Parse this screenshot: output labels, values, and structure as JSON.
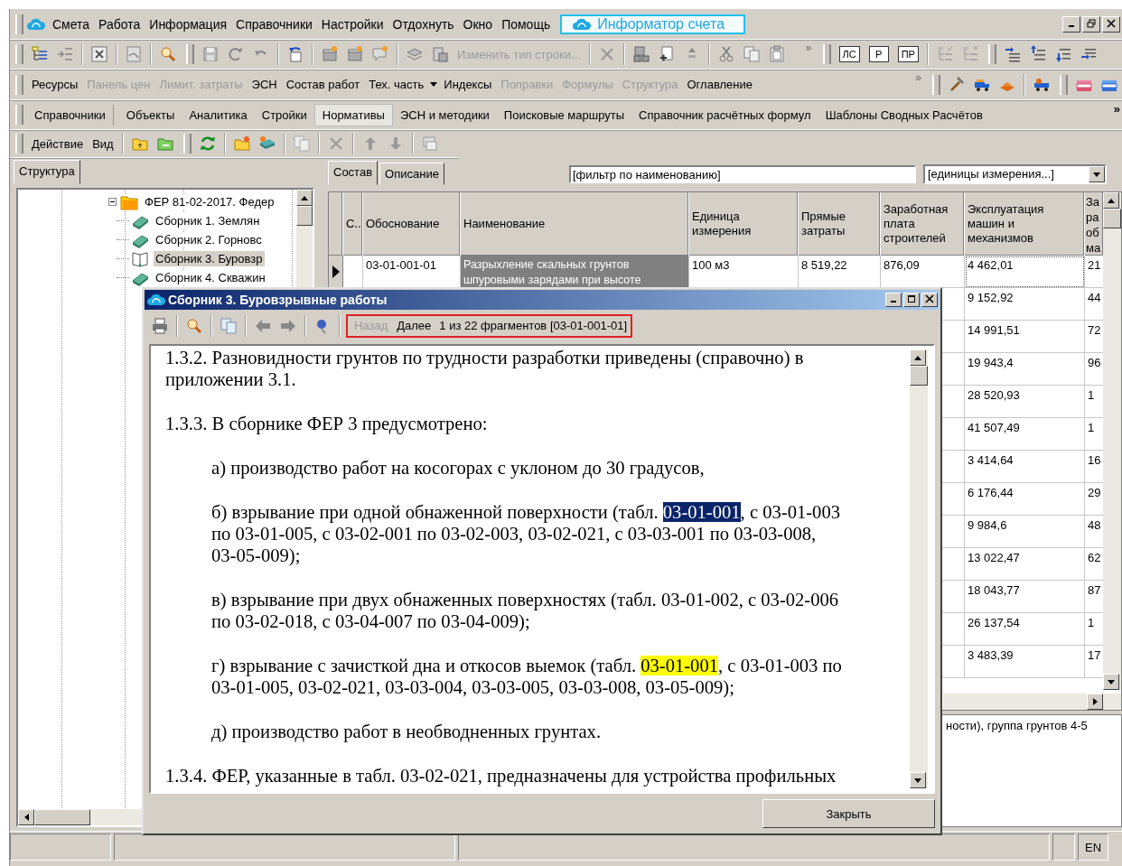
{
  "menu": {
    "items": [
      "Смета",
      "Работа",
      "Информация",
      "Справочники",
      "Настройки",
      "Отдохнуть",
      "Окно",
      "Помощь"
    ],
    "informer": "Информатор счета"
  },
  "toolbar1": {
    "change_row_type": {
      "label": "Изменить тип строки...",
      "disabled": true
    },
    "overflow": "»",
    "badges": [
      "ЛС",
      "Р",
      "ПР"
    ]
  },
  "toolbar2": {
    "buttons": [
      {
        "label": "Ресурсы",
        "disabled": false,
        "dropdown": false
      },
      {
        "label": "Панель цен",
        "disabled": true,
        "dropdown": false
      },
      {
        "label": "Лимит. затраты",
        "disabled": true,
        "dropdown": false
      },
      {
        "label": "ЭСН",
        "disabled": false,
        "dropdown": false
      },
      {
        "label": "Состав работ",
        "disabled": false,
        "dropdown": false
      },
      {
        "label": "Тех. часть",
        "disabled": false,
        "dropdown": true
      },
      {
        "label": "Индексы",
        "disabled": false,
        "dropdown": false
      },
      {
        "label": "Поправки",
        "disabled": true,
        "dropdown": false
      },
      {
        "label": "Формулы",
        "disabled": true,
        "dropdown": false
      },
      {
        "label": "Структура",
        "disabled": true,
        "dropdown": false
      },
      {
        "label": "Оглавление",
        "disabled": false,
        "dropdown": false
      }
    ],
    "overflow": "»"
  },
  "nav_tabs": {
    "items": [
      {
        "label": "Справочники",
        "selected": false
      },
      {
        "label": "Объекты",
        "selected": false
      },
      {
        "label": "Аналитика",
        "selected": false
      },
      {
        "label": "Стройки",
        "selected": false
      },
      {
        "label": "Нормативы",
        "selected": true
      },
      {
        "label": "ЭСН и методики",
        "selected": false
      },
      {
        "label": "Поисковые маршруты",
        "selected": false
      },
      {
        "label": "Справочник расчётных формул",
        "selected": false
      },
      {
        "label": "Шаблоны Сводных Расчётов",
        "selected": false
      }
    ],
    "more": "»"
  },
  "toolbar3": {
    "menus": [
      "Действие",
      "Вид"
    ]
  },
  "left_panel": {
    "tabs": [
      {
        "label": "Структура",
        "selected": true
      }
    ],
    "tree": [
      {
        "label": "ФЕР 81-02-2017. Федер",
        "expanded": true,
        "children": [
          {
            "label": "Сборник 1. Землян",
            "selected": false
          },
          {
            "label": "Сборник 2. Горновс",
            "selected": false
          },
          {
            "label": "Сборник 3. Буровзр",
            "selected": true
          },
          {
            "label": "Сборник 4. Скважин",
            "selected": false
          }
        ]
      }
    ]
  },
  "right_panel": {
    "tabs": [
      {
        "label": "Состав",
        "selected": true
      },
      {
        "label": "Описание",
        "selected": false
      }
    ],
    "name_filter": {
      "value": "[фильтр по наименованию]"
    },
    "unit_filter": {
      "value": "[единицы измерения...]"
    },
    "table": {
      "columns": [
        "С..",
        "Обоснование",
        "Наименование",
        "Единица измерения",
        "Прямые затраты",
        "Заработная плата строителей",
        "Эксплуатация машин и механизмов",
        "За ра об ма"
      ],
      "rows": [
        {
          "selected": true,
          "code": "03-01-001-01",
          "name": "Разрыхление скальных грунтов шпуровыми зарядами при высоте",
          "unit": "100 м3",
          "direct": "8 519,22",
          "wages": "876,09",
          "machines": "4 462,01",
          "column_8": "21"
        },
        {
          "selected": false,
          "machines": "9 152,92",
          "column_8": "44"
        },
        {
          "selected": false,
          "machines": "14 991,51",
          "column_8": "72"
        },
        {
          "selected": false,
          "machines": "19 943,4",
          "column_8": "96"
        },
        {
          "selected": false,
          "machines": "28 520,93",
          "column_8": "1"
        },
        {
          "selected": false,
          "machines": "41 507,49",
          "column_8": "1"
        },
        {
          "selected": false,
          "machines": "3 414,64",
          "column_8": "16"
        },
        {
          "selected": false,
          "machines": "6 176,44",
          "column_8": "29"
        },
        {
          "selected": false,
          "machines": "9 984,6",
          "column_8": "48"
        },
        {
          "selected": false,
          "machines": "13 022,47",
          "column_8": "62"
        },
        {
          "selected": false,
          "machines": "18 043,77",
          "column_8": "87"
        },
        {
          "selected": false,
          "machines": "26 137,54",
          "column_8": "1"
        },
        {
          "selected": false,
          "machines": "3 483,39",
          "column_8": "17"
        }
      ]
    },
    "description": "ности), группа грунтов 4-5"
  },
  "dialog": {
    "title": "Сборник 3. Буровзрывные работы",
    "nav": {
      "back": {
        "label": "Назад",
        "disabled": true
      },
      "next": {
        "label": "Далее",
        "disabled": false
      },
      "position": "1 из 22 фрагментов [03-01-001-01]"
    },
    "paragraphs": [
      {
        "segments": [
          {
            "kind": "plain",
            "text": "1.3.2. Разновидности грунтов по трудности разработки приведены (справочно) в приложении 3.1."
          }
        ]
      },
      {
        "segments": [
          {
            "kind": "plain",
            "text": "1.3.3. В сборнике ФЕР 3 предусмотрено:"
          }
        ],
        "children": [
          {
            "segments": [
              {
                "kind": "plain",
                "text": "а) производство работ на косогорах с уклоном до 30 градусов,"
              }
            ]
          },
          {
            "segments": [
              {
                "kind": "plain",
                "text": "б) взрывание при одной обнаженной поверхности (табл. "
              },
              {
                "kind": "current",
                "text": "03-01-001"
              },
              {
                "kind": "plain",
                "text": ", с 03-01-003 по 03-01-005, с 03-02-001 по 03-02-003, 03-02-021, с 03-03-001 по 03-03-008, 03-05-009);"
              }
            ]
          },
          {
            "segments": [
              {
                "kind": "plain",
                "text": "в) взрывание при двух обнаженных поверхностях (табл. 03-01-002, с 03-02-006 по 03-02-018, с 03-04-007 по 03-04-009);"
              }
            ]
          },
          {
            "segments": [
              {
                "kind": "plain",
                "text": "г) взрывание с зачисткой дна и откосов выемок (табл. "
              },
              {
                "kind": "match",
                "text": "03-01-001"
              },
              {
                "kind": "plain",
                "text": ", с 03-01-003 по 03-01-005, 03-02-021, 03-03-004, 03-03-005, 03-03-008, 03-05-009);"
              }
            ]
          },
          {
            "segments": [
              {
                "kind": "plain",
                "text": "д) производство работ в необводненных грунтах."
              }
            ]
          }
        ]
      },
      {
        "segments": [
          {
            "kind": "plain",
            "text": "1.3.4. ФЕР, указанные в табл. 03-02-021, предназначены для устройства профильных"
          }
        ]
      }
    ],
    "close_button": "Закрыть"
  },
  "status_bar": {
    "language": "EN"
  }
}
